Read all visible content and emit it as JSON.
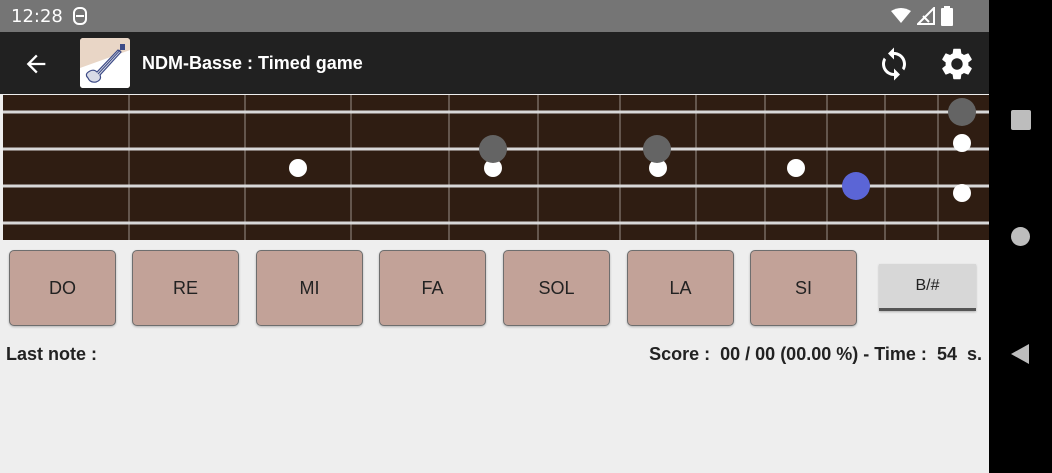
{
  "status_bar": {
    "time": "12:28",
    "icons": [
      "notification-icon",
      "wifi-icon",
      "signal-icon",
      "battery-icon"
    ]
  },
  "app_bar": {
    "back_icon": "arrow-left-icon",
    "title": "NDM-Basse : Timed game",
    "logo": "bass-guitar-logo",
    "actions": [
      "refresh-icon",
      "settings-gear-icon"
    ]
  },
  "fretboard": {
    "strings": 4,
    "frets": 11,
    "colors": {
      "wood": "#2f1d12",
      "fret": "#9a8f88",
      "string": "#d8d8d8",
      "inlay": "#ffffff",
      "marker": "#646464",
      "target": "#5b65d6"
    }
  },
  "notes": {
    "buttons": [
      "DO",
      "RE",
      "MI",
      "FA",
      "SOL",
      "LA",
      "SI"
    ],
    "accidental": "B/#",
    "color": "#c2a298"
  },
  "info": {
    "last_note_label": "Last note :",
    "score_label": "Score :",
    "score_value": "00 / 00 (00.00 %)",
    "time_label": " - Time :",
    "time_value": "54",
    "time_unit": "s."
  },
  "nav_bar": {
    "icons": [
      "recents-square-icon",
      "home-circle-icon",
      "back-triangle-icon"
    ]
  }
}
